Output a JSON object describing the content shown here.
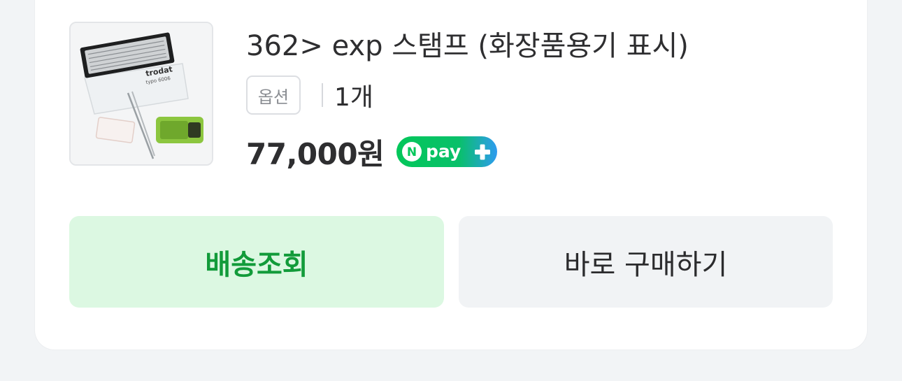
{
  "product": {
    "title": "362> exp 스탬프 (화장품용기 표시)",
    "option_label": "옵션",
    "quantity": "1개",
    "price": "77,000원",
    "thumbnail_brand": "trodat",
    "thumbnail_model": "typo 6006",
    "payment_badge": {
      "logo_letter": "N",
      "text": "pay",
      "icon": "plus-icon"
    }
  },
  "actions": {
    "track_label": "배송조회",
    "buy_label": "바로 구매하기"
  },
  "colors": {
    "track_bg": "#dcf8e2",
    "track_text": "#129b3a",
    "buy_bg": "#f1f3f5",
    "npay_green": "#03c75a",
    "npay_blue": "#2e9bf0"
  }
}
